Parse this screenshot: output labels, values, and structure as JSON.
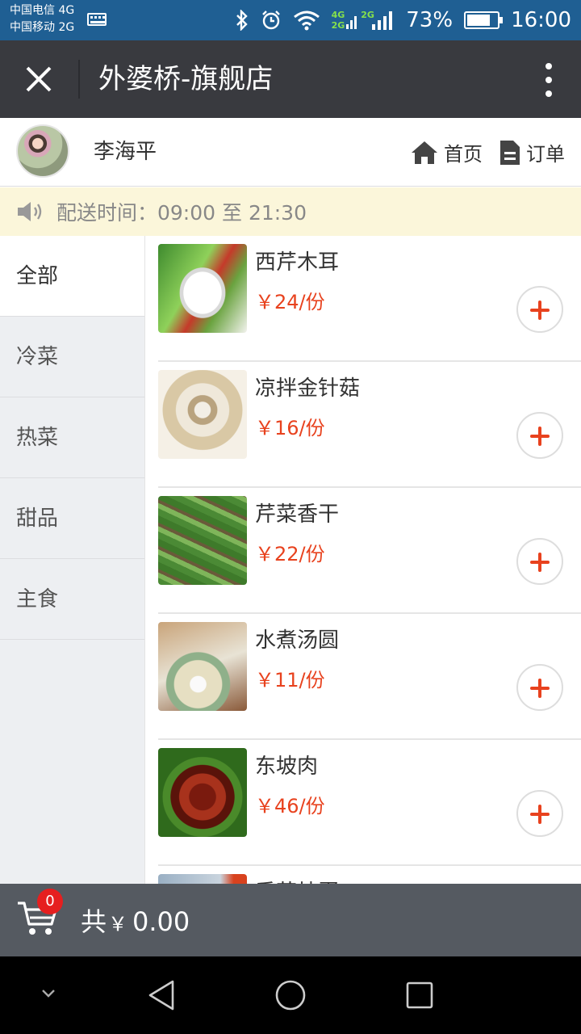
{
  "status_bar": {
    "carrier_1": "中国电信 4G",
    "carrier_2": "中国移动 2G",
    "network_tag_1": "4G",
    "network_tag_2": "2G",
    "network_tag_3": "2G",
    "battery_percent": "73%",
    "time": "16:00"
  },
  "title_bar": {
    "title": "外婆桥-旗舰店"
  },
  "user_bar": {
    "user_name": "李海平",
    "home_label": "首页",
    "orders_label": "订单"
  },
  "notice": {
    "text": "配送时间：09:00 至 21:30"
  },
  "categories": [
    {
      "label": "全部"
    },
    {
      "label": "冷菜"
    },
    {
      "label": "热菜"
    },
    {
      "label": "甜品"
    },
    {
      "label": "主食"
    }
  ],
  "menu_items": [
    {
      "name": "西芹木耳",
      "price": "￥24/份"
    },
    {
      "name": "凉拌金针菇",
      "price": "￥16/份"
    },
    {
      "name": "芹菜香干",
      "price": "￥22/份"
    },
    {
      "name": "水煮汤圆",
      "price": "￥11/份"
    },
    {
      "name": "东坡肉",
      "price": "￥46/份"
    },
    {
      "name": "番茄炒蛋",
      "price": ""
    }
  ],
  "cart": {
    "count": "0",
    "total_prefix": "共",
    "currency": "￥",
    "total": "0.00"
  },
  "colors": {
    "status_bar": "#1f5f93",
    "title_bar": "#393a3f",
    "price": "#e8421e",
    "cart_bar": "#555a61",
    "badge": "#e61f1f"
  }
}
